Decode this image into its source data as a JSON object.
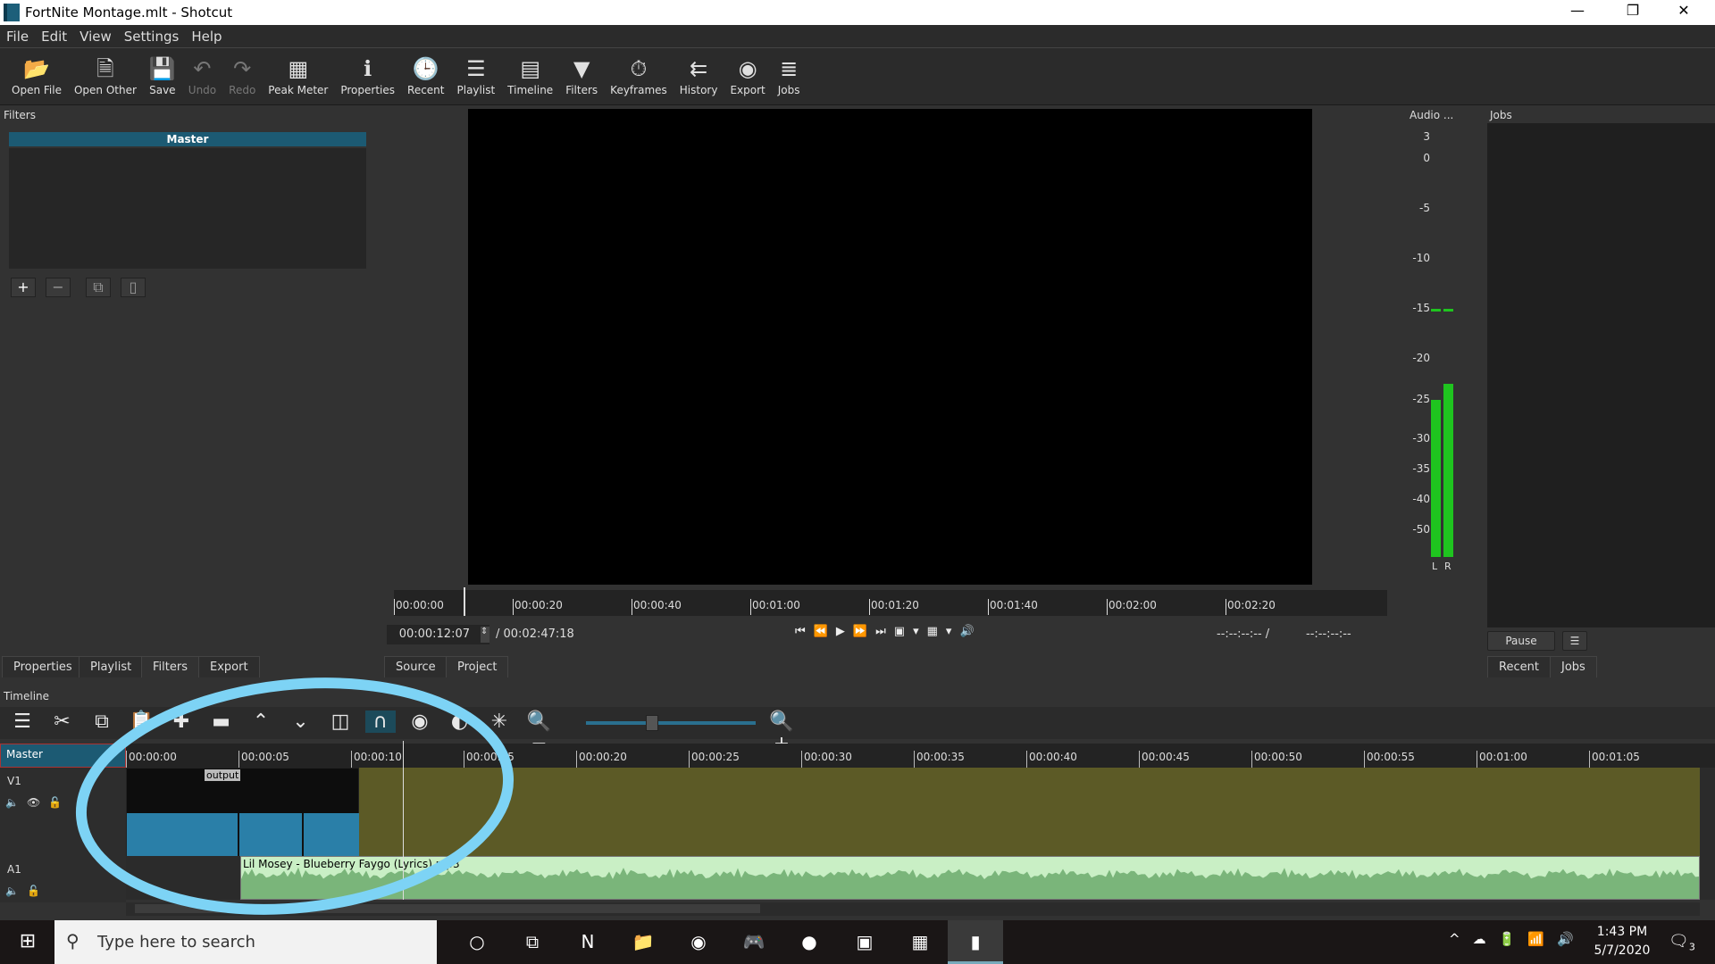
{
  "window": {
    "title": "FortNite Montage.mlt - Shotcut",
    "minimize": "—",
    "restore": "❐",
    "close": "✕"
  },
  "menu": [
    "File",
    "Edit",
    "View",
    "Settings",
    "Help"
  ],
  "toolbar": [
    {
      "label": "Open File",
      "icon": "📂",
      "enabled": true
    },
    {
      "label": "Open Other",
      "icon": "🗎",
      "enabled": true
    },
    {
      "label": "Save",
      "icon": "💾",
      "enabled": true
    },
    {
      "label": "Undo",
      "icon": "↶",
      "enabled": false
    },
    {
      "label": "Redo",
      "icon": "↷",
      "enabled": false
    },
    {
      "label": "Peak Meter",
      "icon": "▦",
      "enabled": true
    },
    {
      "label": "Properties",
      "icon": "ℹ",
      "enabled": true
    },
    {
      "label": "Recent",
      "icon": "🕒",
      "enabled": true
    },
    {
      "label": "Playlist",
      "icon": "☰",
      "enabled": true
    },
    {
      "label": "Timeline",
      "icon": "▤",
      "enabled": true
    },
    {
      "label": "Filters",
      "icon": "▼",
      "enabled": true
    },
    {
      "label": "Keyframes",
      "icon": "⏱",
      "enabled": true
    },
    {
      "label": "History",
      "icon": "⇇",
      "enabled": true
    },
    {
      "label": "Export",
      "icon": "◉",
      "enabled": true
    },
    {
      "label": "Jobs",
      "icon": "≣",
      "enabled": true
    }
  ],
  "filters": {
    "title": "Filters",
    "master": "Master",
    "buttons": [
      "+",
      "−",
      "⧉",
      "▯"
    ]
  },
  "player": {
    "ruler": [
      "00:00:00",
      "00:00:20",
      "00:00:40",
      "00:01:00",
      "00:01:20",
      "00:01:40",
      "00:02:00",
      "00:02:20"
    ],
    "position": "00:00:12:07",
    "duration": "/ 00:02:47:18",
    "in_point": "--:--:--:-- /",
    "out_point": "--:--:--:--",
    "controls": [
      "⏮",
      "⏪",
      "▶",
      "⏩",
      "⏭",
      "▣",
      "▾",
      "▦",
      "▾",
      "🔊"
    ]
  },
  "audio": {
    "title": "Audio ...",
    "scale": [
      "3",
      "0",
      "-5",
      "-10",
      "-15",
      "-20",
      "-25",
      "-30",
      "-35",
      "-40",
      "-50"
    ],
    "channels": [
      "L",
      "R"
    ],
    "level_left_db": -25,
    "level_right_db": -23,
    "peak_db": -15,
    "color": "#1fc41f"
  },
  "jobs": {
    "title": "Jobs",
    "pause": "Pause",
    "menu": "☰"
  },
  "left_tabs": [
    "Properties",
    "Playlist",
    "Filters",
    "Export"
  ],
  "player_tabs": [
    "Source",
    "Project"
  ],
  "right_tabs": [
    "Recent",
    "Jobs"
  ],
  "timeline": {
    "title": "Timeline",
    "tools": [
      "☰",
      "✂",
      "⧉",
      "📋",
      "✚",
      "▬",
      "⌃",
      "⌄",
      "◫",
      "∩",
      "◉",
      "◐",
      "✳",
      "🔍−"
    ],
    "zoom_in": "🔍+",
    "zoom_level": 0.35,
    "master": "Master",
    "ruler": [
      "00:00:00",
      "00:00:05",
      "00:00:10",
      "00:00:15",
      "00:00:20",
      "00:00:25",
      "00:00:30",
      "00:00:35",
      "00:00:40",
      "00:00:45",
      "00:00:50",
      "00:00:55",
      "00:01:00",
      "00:01:05"
    ],
    "tracks": [
      {
        "name": "V1",
        "icons": [
          "🔈",
          "👁",
          "🔓"
        ]
      },
      {
        "name": "A1",
        "icons": [
          "🔈",
          "🔓"
        ]
      }
    ],
    "video_clip_label": "output",
    "audio_clip_label": "Lil Mosey - Blueberry Faygo (Lyrics).mp3",
    "annotation_color": "#7dd3f5"
  },
  "taskbar": {
    "search_placeholder": "Type here to search",
    "time": "1:43 PM",
    "date": "5/7/2020",
    "notifications": "3",
    "apps": [
      "○",
      "⧉",
      "N",
      "📁",
      "◉",
      "🎮",
      "●",
      "▣",
      "▦",
      "▮"
    ],
    "tray": [
      "^",
      "☁",
      "🔋",
      "📶",
      "🔊"
    ]
  }
}
